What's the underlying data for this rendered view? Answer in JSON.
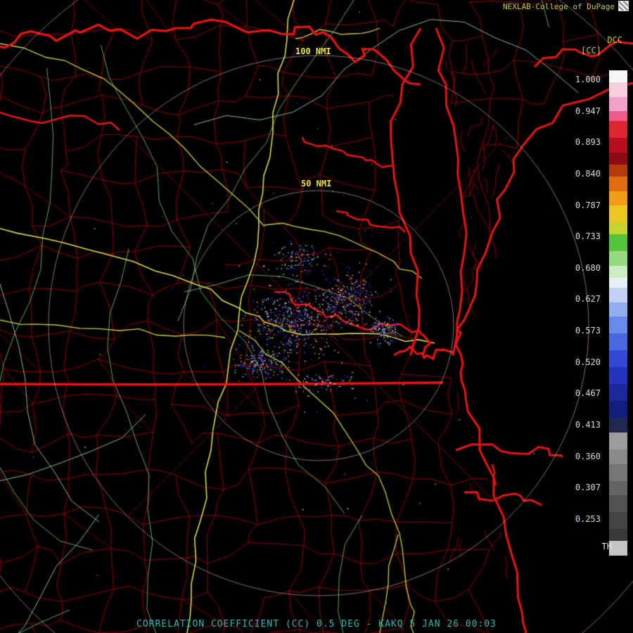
{
  "header": {
    "attribution": "NEXLAB-College of DuPage"
  },
  "rings": {
    "outer_label": "100 NMI",
    "inner_label": "50 NMI"
  },
  "caption": {
    "text": "CORRELATION COEFFICIENT (CC) 0.5 DEG - KAKQ 5 JAN 26 00:03"
  },
  "colorbar": {
    "title": "DCC",
    "subtitle": "[CC]",
    "threshold_label": "TH",
    "tick_labels": [
      "1.000",
      "0.947",
      "0.893",
      "0.840",
      "0.787",
      "0.733",
      "0.680",
      "0.627",
      "0.573",
      "0.520",
      "0.467",
      "0.413",
      "0.360",
      "0.307",
      "0.253"
    ],
    "segments": [
      {
        "color": "#f6f6f6",
        "h": 10
      },
      {
        "color": "#f6cede",
        "h": 12
      },
      {
        "color": "#f2a2c6",
        "h": 12
      },
      {
        "color": "#ee5a8c",
        "h": 8
      },
      {
        "color": "#e02430",
        "h": 14
      },
      {
        "color": "#b80e1e",
        "h": 12
      },
      {
        "color": "#8e0a14",
        "h": 10
      },
      {
        "color": "#b43c0c",
        "h": 10
      },
      {
        "color": "#e06c10",
        "h": 12
      },
      {
        "color": "#f09c14",
        "h": 12
      },
      {
        "color": "#ecc81e",
        "h": 14
      },
      {
        "color": "#c6d42c",
        "h": 10
      },
      {
        "color": "#54c438",
        "h": 14
      },
      {
        "color": "#96dc7e",
        "h": 12
      },
      {
        "color": "#ccecc4",
        "h": 10
      },
      {
        "color": "#e6eef6",
        "h": 8
      },
      {
        "color": "#c2d2f2",
        "h": 12
      },
      {
        "color": "#92aef0",
        "h": 12
      },
      {
        "color": "#6a8aea",
        "h": 14
      },
      {
        "color": "#4a66e0",
        "h": 14
      },
      {
        "color": "#3248d2",
        "h": 14
      },
      {
        "color": "#2234ba",
        "h": 14
      },
      {
        "color": "#1a289a",
        "h": 14
      },
      {
        "color": "#121e7c",
        "h": 14
      },
      {
        "color": "#20284e",
        "h": 12
      },
      {
        "color": "#9c9c9c",
        "h": 14
      },
      {
        "color": "#8a8a8a",
        "h": 12
      },
      {
        "color": "#767676",
        "h": 14
      },
      {
        "color": "#646464",
        "h": 12
      },
      {
        "color": "#525252",
        "h": 14
      },
      {
        "color": "#444444",
        "h": 14
      },
      {
        "color": "#3a3a3a",
        "h": 10
      },
      {
        "color": "#c4c4c4",
        "h": 12
      }
    ]
  },
  "ui_colors": {
    "background": "#000000",
    "label_yellow": "#c8c832",
    "tick_gray": "#d8d8d8",
    "caption_teal": "#2ab4b4"
  },
  "map_colors": {
    "county": "#9b0000",
    "coastline": "#e81414",
    "road_green": "#74c274",
    "road_green_alt": "#a6d8a6",
    "highway_yellow": "#d8d83c",
    "highway_bright": "#e6e64a",
    "range_ring": "#f4c8c8",
    "azimuth": "#8c1414"
  },
  "radar_palette": {
    "blue_dark": "#0a1ecc",
    "blue": "#1a3cf0",
    "blue_mid": "#3a5cf8",
    "blue_light": "#7a96ff",
    "pale_blue": "#9ab8ff",
    "lavender": "#cdd8ff",
    "yellow": "#e8d22a",
    "dark_yellow": "#c8b820",
    "orange": "#f09020",
    "red": "#e03020",
    "white": "#f0f0f0",
    "pink": "#f8b8d0",
    "green": "#50c050"
  }
}
